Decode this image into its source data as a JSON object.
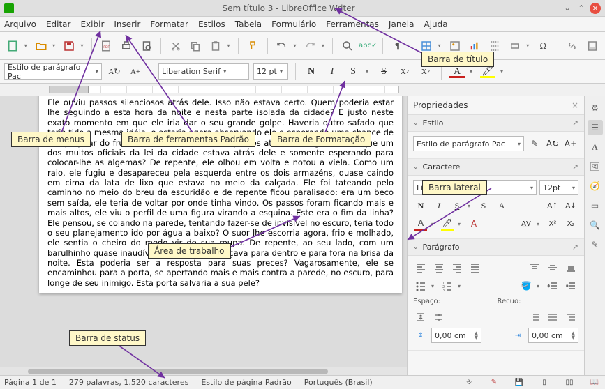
{
  "title": "Sem título 3 - LibreOffice Writer",
  "menus": [
    "Arquivo",
    "Editar",
    "Exibir",
    "Inserir",
    "Formatar",
    "Estilos",
    "Tabela",
    "Formulário",
    "Ferramentas",
    "Janela",
    "Ajuda"
  ],
  "formatting": {
    "paragraph_style": "Estilo de parágrafo Padrão",
    "paragraph_style_short": "Estilo de parágrafo Pac",
    "font_name": "Liberation Serif",
    "font_size": "12 pt",
    "font_size_short": "12pt"
  },
  "document_text": "Ele ouviu passos silenciosos atrás dele. Isso não estava certo. Quem poderia estar lhe seguindo a esta hora da noite e nesta parte isolada da cidade? E justo neste exato momento em que ele iria dar o seu grande golpe. Haveria outro safado que teria tido a mesma idéia, e estaria agora observando ele e esperando uma chance de se apropriar do fruto de seu trabalho? Ou os passos atrás dele significariam que um dos muitos oficiais da lei da cidade estava atrás dele e somente esperando para colocar-lhe as algemas? De repente, ele olhou em volta e notou a viela. Como um raio, ele fugiu e desapareceu pela esquerda entre os dois armazéns, quase caindo em cima da lata de lixo que estava no meio da calçada. Ele foi tateando pelo caminho no meio do breu da escuridão e de repente ficou paralisado: era um beco sem saída, ele teria de voltar por onde tinha vindo. Os passos foram ficando mais e mais altos, ele viu o perfil de uma figura virando a esquina. Este era o fim da linha? Ele pensou, se colando na parede, tentando fazer-se de invisível no escuro, teria todo o seu planejamento ido por água a baixo? O suor lhe escorria agora, frio e molhado, ele sentia o cheiro do medo vir de sua roupa. De repente, ao seu lado, com um barulhinho quase inaudível, uma porta balançava para dentro e para fora na brisa da noite. Esta poderia ser a resposta para suas preces? Vagarosamente, ele se encaminhou para a porta, se apertando mais e mais contra a parede, no escuro, para longe de seu inimigo. Esta porta salvaria a sua pele?",
  "sidebar": {
    "title": "Propriedades",
    "sections": {
      "style": "Estilo",
      "character": "Caractere",
      "paragraph": "Parágrafo"
    },
    "spacing_label": "Espaço:",
    "indent_label": "Recuo:",
    "spacing_value": "0,00 cm",
    "indent_value": "0,00 cm"
  },
  "status": {
    "page": "Página 1 de 1",
    "words": "279 palavras, 1.520 caracteres",
    "page_style": "Estilo de página Padrão",
    "language": "Português (Brasil)"
  },
  "callouts": {
    "title_bar": "Barra de título",
    "menu_bar": "Barra de menus",
    "standard_toolbar": "Barra de ferramentas Padrão",
    "formatting_toolbar": "Barra de Formatação",
    "sidebar": "Barra lateral",
    "work_area": "Área de trabalho",
    "status_bar": "Barra de status"
  }
}
